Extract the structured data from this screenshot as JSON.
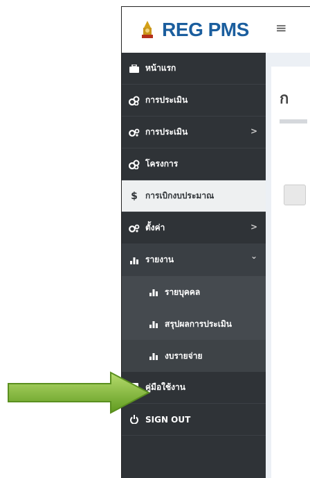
{
  "brand": {
    "title": "REG PMS"
  },
  "sidebar": {
    "items": [
      {
        "label": "หน้าแรก",
        "icon": "briefcase-icon"
      },
      {
        "label": "การประเมิน",
        "icon": "cogs-icon"
      },
      {
        "label": "การประเมิน",
        "icon": "gears-icon",
        "chevron": ">"
      },
      {
        "label": "โครงการ",
        "icon": "cogs-icon"
      },
      {
        "label": "การเบิกงบประมาณ",
        "icon": "dollar-icon"
      },
      {
        "label": "ตั้งค่า",
        "icon": "gears-icon",
        "chevron": ">"
      },
      {
        "label": "รายงาน",
        "icon": "bar-chart-icon",
        "chevron": "⌄"
      },
      {
        "label": "คู่มือใช้งาน",
        "icon": "book-icon"
      },
      {
        "label": "SIGN OUT",
        "icon": "power-icon"
      }
    ],
    "report_sub": [
      {
        "label": "รายบุคคล",
        "icon": "bar-chart-icon"
      },
      {
        "label": "สรุปผลการประเมิน",
        "icon": "bar-chart-icon"
      },
      {
        "label": "งบรายจ่าย",
        "icon": "bar-chart-icon"
      }
    ]
  },
  "content": {
    "title_partial": "ก"
  },
  "colors": {
    "sidebar_bg": "#2f3337",
    "active_bg": "#eef0f1",
    "brand": "#1b5e9e",
    "arrow": "#7dbb2f"
  }
}
